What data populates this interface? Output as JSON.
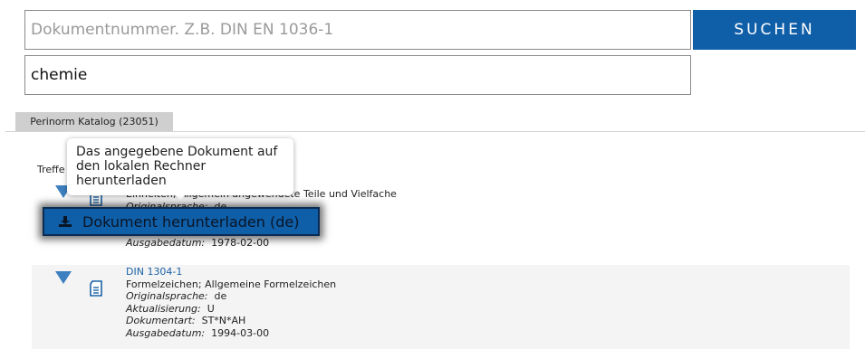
{
  "search": {
    "docnum_placeholder": "Dokumentnummer. Z.B. DIN EN 1036-1",
    "query_value": "chemie",
    "button_label": "SUCHEN"
  },
  "tabs": [
    {
      "label": "Perinorm Katalog (23051)"
    }
  ],
  "treffer_label": "Treffe",
  "tooltip": {
    "text": "Das angegebene Dokument auf den lokalen Rechner herunterladen"
  },
  "download_button": {
    "label": "Dokument herunterladen (de)",
    "icon": "download-icon"
  },
  "results": [
    {
      "title_visible": "Einheiten; Allgemein angewendete Teile und Vielfache",
      "orig_label": "Originalsprache:",
      "orig_value": "de",
      "date_label": "Ausgabedatum:",
      "date_value": "1978-02-00"
    },
    {
      "doc_number": "DIN 1304-1",
      "title": "Formelzeichen; Allgemeine Formelzeichen",
      "orig_label": "Originalsprache:",
      "orig_value": "de",
      "update_label": "Aktualisierung:",
      "update_value": "U",
      "type_label": "Dokumentart:",
      "type_value": "ST*N*AH",
      "date_label": "Ausgabedatum:",
      "date_value": "1994-03-00"
    }
  ],
  "colors": {
    "accent": "#0f5ea8",
    "link": "#1a62a6",
    "toggle": "#3d7fbf",
    "tab_bg": "#cfcfcf"
  }
}
